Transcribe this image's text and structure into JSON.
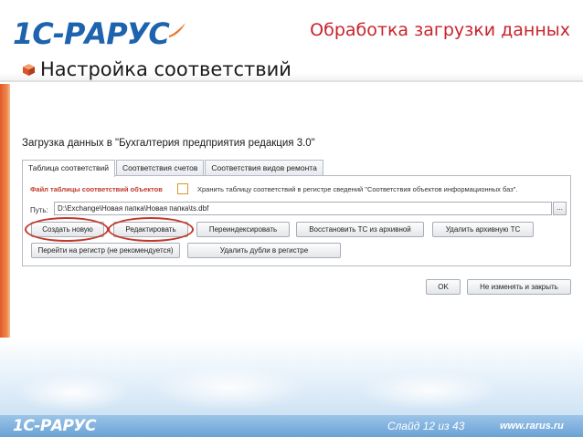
{
  "header": {
    "logo": "1С-РАРУС",
    "slide_title": "Обработка загрузки данных",
    "section_title": "Настройка соответствий"
  },
  "form": {
    "title": "Загрузка данных в \"Бухгалтерия предприятия редакция 3.0\"",
    "tabs": [
      {
        "label": "Таблица соответствий",
        "active": true
      },
      {
        "label": "Соответствия счетов",
        "active": false
      },
      {
        "label": "Соответствия видов ремонта",
        "active": false
      }
    ],
    "file_label": "Файл таблицы соответствий объектов",
    "store_checkbox_label": "Хранить таблицу соответствий в регистре сведений \"Соответствия объектов информационных баз\".",
    "store_checked": false,
    "path_label": "Путь:",
    "path_value": "D:\\Exchange\\Новая папка\\Новая папка\\ts.dbf",
    "path_button": "...",
    "buttons": {
      "create": "Создать новую",
      "edit": "Редактировать",
      "reindex": "Переиндексировать",
      "restore": "Восстановить ТС из архивной",
      "delete_archive": "Удалить архивную ТС",
      "goto_register": "Перейти на регистр (не рекомендуется)",
      "delete_dups": "Удалить дубли в регистре"
    },
    "ok": "OK",
    "close": "Не изменять и закрыть"
  },
  "footer": {
    "logo": "1С-РАРУС",
    "slide_counter": "Слайд 12 из 43",
    "url": "www.rarus.ru"
  },
  "colors": {
    "brand_blue": "#1d63ae",
    "title_red": "#c8242c",
    "highlight_red": "#c0392b",
    "footer_blue": "#6aa2d6"
  }
}
